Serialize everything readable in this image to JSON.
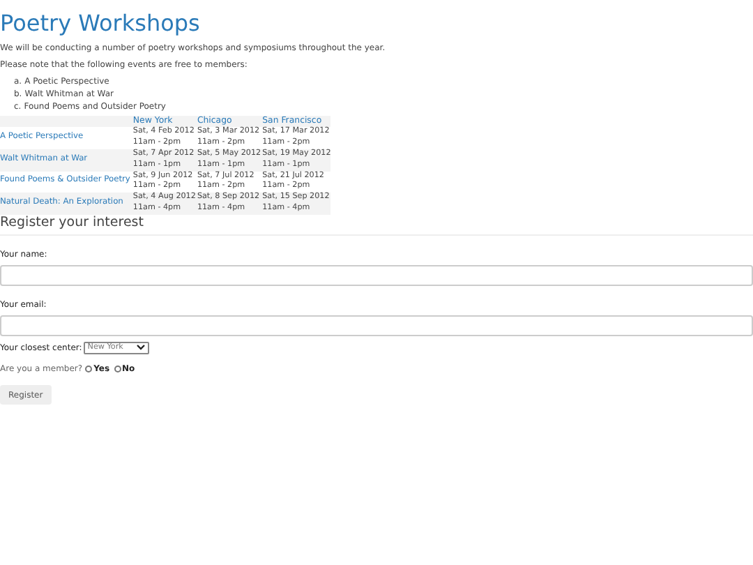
{
  "title": "Poetry Workshops",
  "intro": "We will be conducting a number of poetry workshops and symposiums throughout the year.",
  "note": "Please note that the following events are free to members:",
  "free_events": [
    {
      "marker": "a.",
      "text": "A Poetic Perspective"
    },
    {
      "marker": "b.",
      "text": "Walt Whitman at War"
    },
    {
      "marker": "c.",
      "text": "Found Poems and Outsider Poetry"
    }
  ],
  "table": {
    "columns": [
      "New York",
      "Chicago",
      "San Francisco"
    ],
    "rows": [
      {
        "event": "A Poetic Perspective",
        "cells": [
          [
            "Sat, 4 Feb 2012",
            "11am - 2pm"
          ],
          [
            "Sat, 3 Mar 2012",
            "11am - 2pm"
          ],
          [
            "Sat, 17 Mar 2012",
            "11am - 2pm"
          ]
        ]
      },
      {
        "event": "Walt Whitman at War",
        "cells": [
          [
            "Sat, 7 Apr 2012",
            "11am - 1pm"
          ],
          [
            "Sat, 5 May 2012",
            "11am - 1pm"
          ],
          [
            "Sat, 19 May 2012",
            "11am - 1pm"
          ]
        ]
      },
      {
        "event": "Found Poems & Outsider Poetry",
        "cells": [
          [
            "Sat, 9 Jun 2012",
            "11am - 2pm"
          ],
          [
            "Sat, 7 Jul 2012",
            "11am - 2pm"
          ],
          [
            "Sat, 21 Jul 2012",
            "11am - 2pm"
          ]
        ]
      },
      {
        "event": "Natural Death: An Exploration",
        "cells": [
          [
            "Sat, 4 Aug 2012",
            "11am - 4pm"
          ],
          [
            "Sat, 8 Sep 2012",
            "11am - 4pm"
          ],
          [
            "Sat, 15 Sep 2012",
            "11am - 4pm"
          ]
        ]
      }
    ]
  },
  "form": {
    "heading": "Register your interest",
    "name_label": "Your name:",
    "email_label": "Your email:",
    "center_label": "Your closest center:",
    "center_value": "New York",
    "member_question": "Are you a member?",
    "member_options": [
      {
        "label": "Yes",
        "selected": false
      },
      {
        "label": "No",
        "selected": false
      }
    ],
    "submit": "Register"
  }
}
